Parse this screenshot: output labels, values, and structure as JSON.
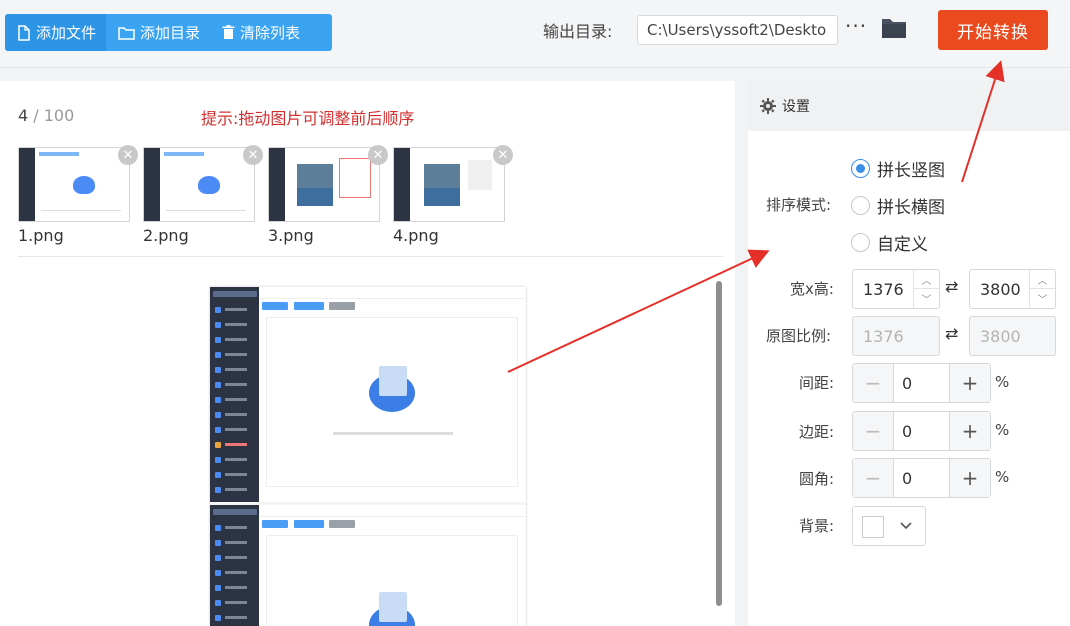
{
  "toolbar": {
    "add_file": "添加文件",
    "add_dir": "添加目录",
    "clear_list": "清除列表",
    "output_label": "输出目录:",
    "output_path": "C:\\Users\\yssoft2\\Deskto",
    "more": "···",
    "start": "开始转换"
  },
  "list": {
    "count_current": "4",
    "count_sep": " / ",
    "count_total": "100",
    "hint": "提示:拖动图片可调整前后顺序",
    "files": [
      {
        "name": "1.png"
      },
      {
        "name": "2.png"
      },
      {
        "name": "3.png"
      },
      {
        "name": "4.png"
      }
    ]
  },
  "settings": {
    "title": "设置",
    "sort_label": "排序模式:",
    "sort_options": [
      "拼长竖图",
      "拼长横图",
      "自定义"
    ],
    "sort_selected": 0,
    "size_label": "宽x高:",
    "width": "1376",
    "height": "3800",
    "ratio_label": "原图比例:",
    "ratio_width": "1376",
    "ratio_height": "3800",
    "spacing_label": "间距:",
    "spacing_value": "0",
    "margin_label": "边距:",
    "margin_value": "0",
    "radius_label": "圆角:",
    "radius_value": "0",
    "percent": "%",
    "bg_label": "背景:",
    "bg_color": "#ffffff"
  },
  "colors": {
    "accent": "#3aa4f3",
    "start": "#ea4a1d",
    "hint": "#d32f2f",
    "annotation": "#e5302a"
  }
}
